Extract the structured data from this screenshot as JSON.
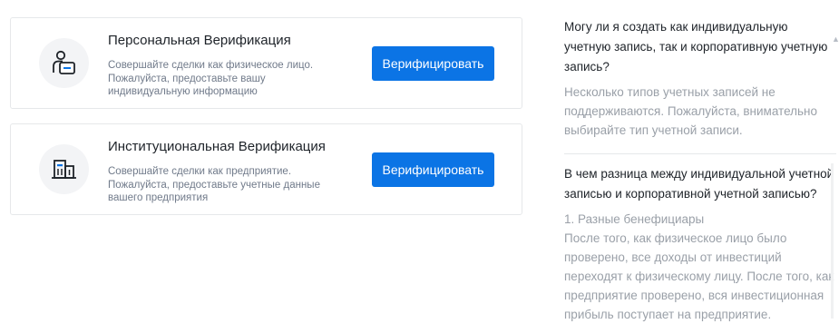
{
  "verification": {
    "personal": {
      "title": "Персональная Верификация",
      "description": "Совершайте сделки как физическое лицо. Пожалуйста, предоставьте вашу индивидуальную информацию",
      "button": "Верифицировать",
      "icon": "user-id-icon"
    },
    "institutional": {
      "title": "Институциональная Верификация",
      "description": "Совершайте сделки как предприятие. Пожалуйста, предоставьте учетные данные вашего предприятия",
      "button": "Верифицировать",
      "icon": "building-icon"
    }
  },
  "faq": [
    {
      "question": "Могу ли я создать как индивидуальную учетную запись, так и корпоративную учетную запись?",
      "answer": "Несколько типов учетных записей не поддерживаются. Пожалуйста, внимательно выбирайте тип учетной записи."
    },
    {
      "question": "В чем разница между индивидуальной учетной записью и корпоративной учетной записью?",
      "answer_point": "1. Разные бенефициары",
      "answer": "После того, как физическое лицо было проверено, все доходы от инвестиций переходят к физическому лицу. После того, как предприятие проверено, вся инвестиционная прибыль поступает на предприятие."
    }
  ],
  "colors": {
    "accent": "#0b74e5",
    "title_text": "#1e2329",
    "secondary_text": "#707a8a",
    "muted_text": "#9aa0a8"
  }
}
